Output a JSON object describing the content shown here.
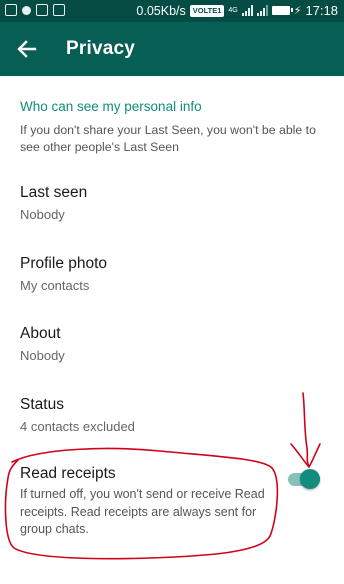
{
  "status_bar": {
    "speed": "0.05Kb/s",
    "volte": "VOLTE1",
    "network": "4G",
    "time": "17:18"
  },
  "header": {
    "title": "Privacy",
    "back_icon": "arrow-left-icon"
  },
  "section": {
    "header": "Who can see my personal info",
    "description": "If you don't share your Last Seen, you won't be able to see other people's Last Seen"
  },
  "settings": [
    {
      "title": "Last seen",
      "value": "Nobody"
    },
    {
      "title": "Profile photo",
      "value": "My contacts"
    },
    {
      "title": "About",
      "value": "Nobody"
    },
    {
      "title": "Status",
      "value": "4 contacts excluded"
    }
  ],
  "read_receipts": {
    "title": "Read receipts",
    "description": "If turned off, you won't send or receive Read receipts. Read receipts are always sent for group chats.",
    "enabled": true
  },
  "colors": {
    "status_bar": "#054d44",
    "app_bar": "#075e54",
    "accent": "#128c7e",
    "annotation": "#d0021b"
  }
}
